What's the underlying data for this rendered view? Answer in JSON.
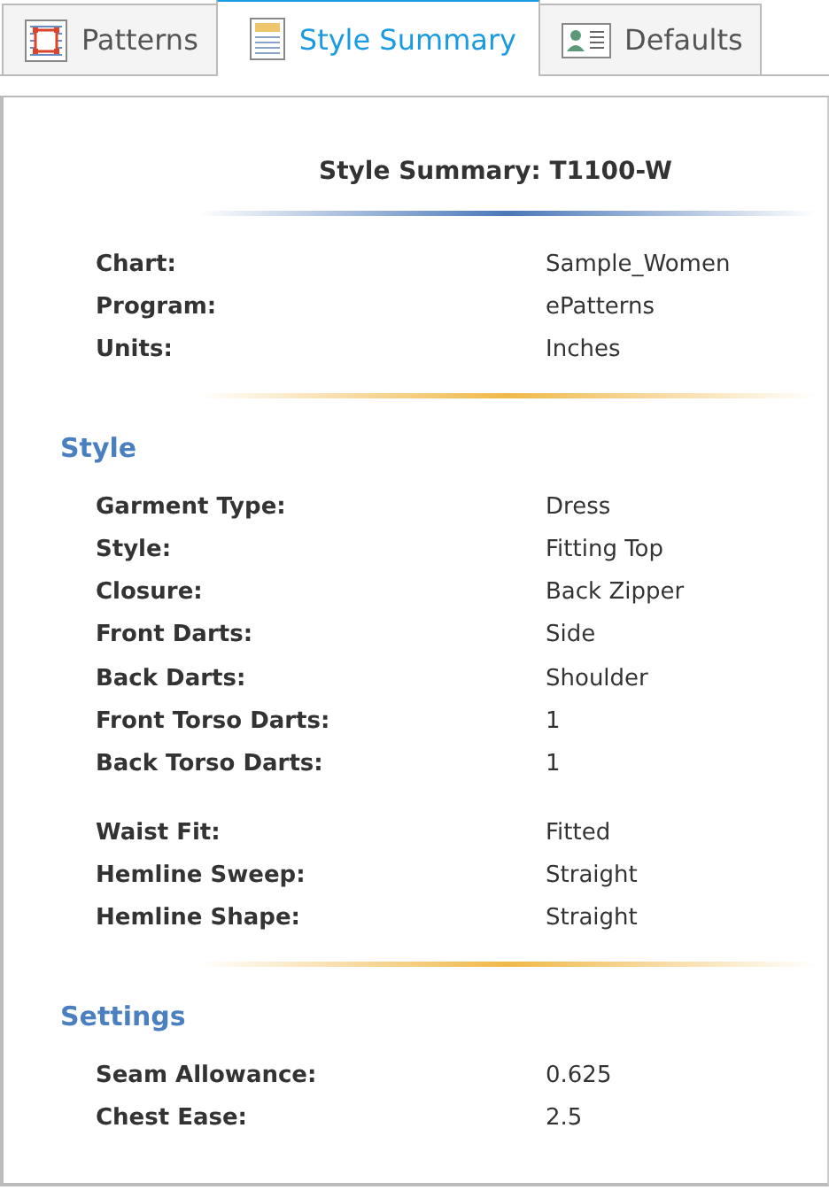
{
  "tabs": [
    {
      "label": "Patterns",
      "kind": "patterns",
      "selected": false
    },
    {
      "label": "Style Summary",
      "kind": "summary",
      "selected": true
    },
    {
      "label": "Defaults",
      "kind": "defaults",
      "selected": false
    }
  ],
  "title": "Style Summary: T1100-W",
  "header_rows": [
    {
      "label": "Chart:",
      "value": "Sample_Women"
    },
    {
      "label": "Program:",
      "value": "ePatterns"
    },
    {
      "label": "Units:",
      "value": "Inches"
    }
  ],
  "sections": [
    {
      "heading": "Style",
      "groups": [
        [
          {
            "label": "Garment Type:",
            "value": "Dress"
          },
          {
            "label": "Style:",
            "value": "Fitting Top"
          },
          {
            "label": "Closure:",
            "value": "Back Zipper"
          },
          {
            "label": "Front Darts:",
            "value": "Side"
          },
          {
            "label": "Back Darts:",
            "value": "Shoulder"
          },
          {
            "label": "Front Torso Darts:",
            "value": "1"
          },
          {
            "label": "Back Torso Darts:",
            "value": "1"
          }
        ],
        [
          {
            "label": "Waist Fit:",
            "value": "Fitted"
          },
          {
            "label": "Hemline Sweep:",
            "value": "Straight"
          },
          {
            "label": "Hemline Shape:",
            "value": "Straight"
          }
        ]
      ]
    },
    {
      "heading": "Settings",
      "groups": [
        [
          {
            "label": "Seam Allowance:",
            "value": "0.625"
          },
          {
            "label": "Chest Ease:",
            "value": "2.5"
          }
        ]
      ]
    }
  ]
}
